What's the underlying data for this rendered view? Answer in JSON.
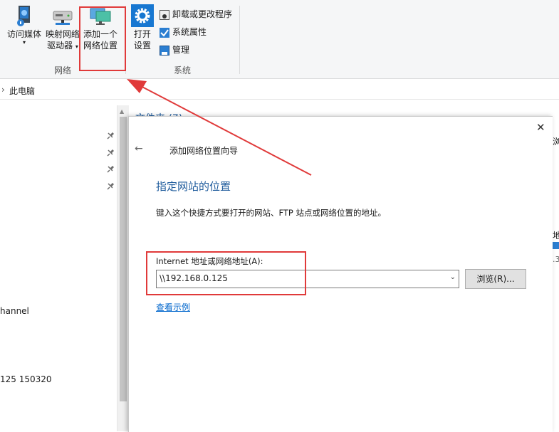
{
  "ribbon": {
    "access_media": "访问媒体",
    "map_drive_line1": "映射网络",
    "map_drive_line2": "驱动器",
    "add_location_line1": "添加一个",
    "add_location_line2": "网络位置",
    "open_settings_line1": "打开",
    "open_settings_line2": "设置",
    "uninstall": "卸载或更改程序",
    "system_props": "系统属性",
    "manage": "管理",
    "group_network": "网络",
    "group_system": "系统"
  },
  "address_bar": {
    "separator": "›",
    "location": "此电脑"
  },
  "left_pane": {
    "item_channel": "hannel",
    "item_number": "125 150320"
  },
  "background": {
    "folder_header": "文件夹 (7)",
    "right_fragment1": "浏",
    "right_fragment2": "地",
    "right_fragment3": ".3"
  },
  "dialog": {
    "title": "添加网络位置向导",
    "heading": "指定网站的位置",
    "description": "键入这个快捷方式要打开的网站、FTP 站点或网络位置的地址。",
    "field_label": "Internet 地址或网络地址(A):",
    "field_value": "\\\\192.168.0.125",
    "browse_label": "浏览(R)...",
    "examples_link": "查看示例",
    "close_glyph": "✕",
    "back_glyph": "←"
  },
  "colors": {
    "heading_blue": "#1e5b9c",
    "link_blue": "#0066cc",
    "annotation_red": "#e03a3a"
  }
}
